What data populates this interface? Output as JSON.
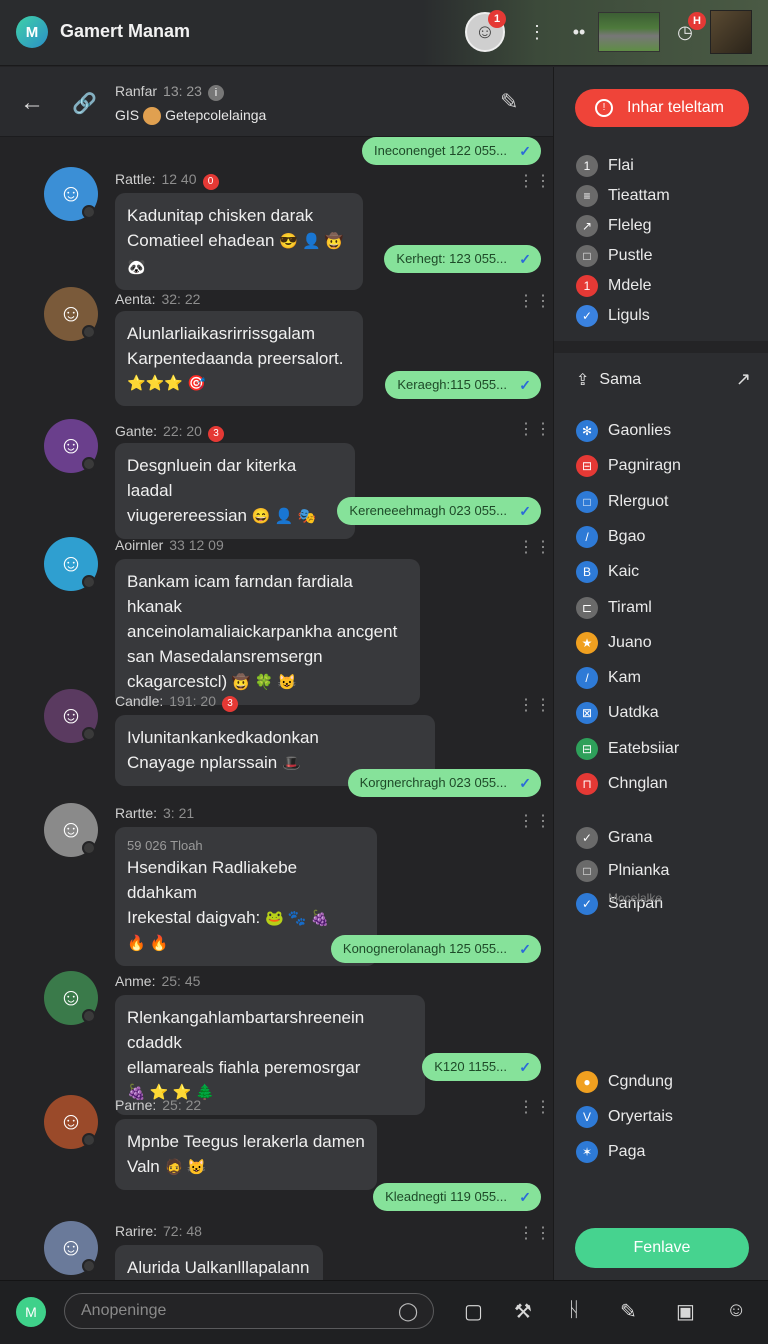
{
  "app": {
    "title": "Gamert Manam",
    "logo": "M"
  },
  "top": {
    "avatar_badge": "1",
    "profile_badge": "H",
    "dots_icon": "⋮",
    "more_icon": "••",
    "timer_icon": "◷"
  },
  "chat_header": {
    "name": "Ranfar",
    "time": "13: 23",
    "info": "i",
    "sub_prefix": "GIS",
    "sub_text": "Getepcolelainga"
  },
  "messages": [
    {
      "id": 1,
      "top": 0,
      "receipt": "Ineconenget 122 055..."
    },
    {
      "id": 2,
      "name": "Rattle:",
      "time": "12 40",
      "badge": "0",
      "avatar_color": "#3b8fd6",
      "text": [
        "Kadunitap chisken darak",
        "Comatieel ehadean"
      ],
      "emoji": "😎 👤 🤠 🐼",
      "receipt": "Kerhegt: 123 055..."
    },
    {
      "id": 3,
      "name": "Aenta:",
      "time": "32: 22",
      "badge": "",
      "avatar_color": "#7a5a3a",
      "text": [
        "Alunlarliaikasrirrissgalam",
        "Karpentedaanda preersalort."
      ],
      "emoji": "⭐⭐⭐ 🎯",
      "receipt": "Keraegh:115 055..."
    },
    {
      "id": 4,
      "name": "Gante:",
      "time": "22: 20",
      "badge": "3",
      "avatar_color": "#6a3f8c",
      "text": [
        "Desgnluein dar kiterka laadal",
        "viugerereessian"
      ],
      "emoji": "😄 👤 🎭",
      "receipt": "Kereneeehmagh 023 055..."
    },
    {
      "id": 5,
      "name": "Aoirnler",
      "time": "33 12 09",
      "badge": "",
      "avatar_color": "#2f9fd0",
      "text": [
        "Bankam icam farndan fardiala hkanak",
        "anceinolamaliaickarpankha ancgent",
        "san Masedalansremsergn",
        "ckagarcestcl)"
      ],
      "emoji": "🤠 🍀 😺",
      "receipt": ""
    },
    {
      "id": 6,
      "name": "Candle:",
      "time": "191: 20",
      "badge": "3",
      "avatar_color": "#5a3a60",
      "text": [
        "Ivlunitankankedkadonkan",
        "Cnayage nplarssain"
      ],
      "emoji": "🎩",
      "receipt": "Korgnerchragh 023 055..."
    },
    {
      "id": 7,
      "name": "Rartte:",
      "time": "3: 21",
      "badge": "",
      "avatar_color": "#8a8a8a",
      "small": "59 026 Tloah",
      "text": [
        "Hsendikan Radliakebe ddahkam",
        "Irekestal daigvah:"
      ],
      "emoji": "🐸 🐾 🍇",
      "emoji2": "🔥 🔥",
      "receipt": "Konognerolanagh 125 055..."
    },
    {
      "id": 8,
      "name": "Anme:",
      "time": "25: 45",
      "badge": "",
      "avatar_color": "#3a7a4a",
      "text": [
        "Rlenkangahlambartarshreenein cdaddk",
        "ellamareals fiahla peremosrgar"
      ],
      "emoji": "🍇 ⭐ ⭐ 🌲",
      "receipt": "K120 1155..."
    },
    {
      "id": 9,
      "name": "Parne:",
      "time": "25: 22",
      "badge": "",
      "avatar_color": "#9a4a2a",
      "text": [
        "Mpnbe Teegus lerakerla damen",
        "Valn"
      ],
      "emoji": "🧔 😺",
      "receipt": "Kleadnegti 119 055..."
    },
    {
      "id": 10,
      "name": "Rarire:",
      "time": "72: 48",
      "badge": "",
      "avatar_color": "#6a7a9a",
      "text": [
        "Alurida Ualkanlllapalann"
      ],
      "emoji": "",
      "receipt": ""
    }
  ],
  "right_panel": {
    "cta_label": "Inhar teleltam",
    "group1": [
      {
        "label": "Flai",
        "icon": "1",
        "color": "#6a6a6a"
      },
      {
        "label": "Tieattam",
        "icon": "≡",
        "color": "#6a6a6a"
      },
      {
        "label": "Fleleg",
        "icon": "↗",
        "color": "#6a6a6a"
      },
      {
        "label": "Pustle",
        "icon": "□",
        "color": "#6a6a6a"
      },
      {
        "label": "Mdele",
        "icon": "1",
        "color": "#e53935"
      },
      {
        "label": "Liguls",
        "icon": "✓",
        "color": "#3a82e0"
      }
    ],
    "share_label": "Sama",
    "group2": [
      {
        "label": "Gaonlies",
        "icon": "✻",
        "color": "#2e7ad6"
      },
      {
        "label": "Pagniragn",
        "icon": "⊟",
        "color": "#e53935"
      },
      {
        "label": "Rlerguot",
        "icon": "□",
        "color": "#2e7ad6"
      },
      {
        "label": "Bgao",
        "icon": "/",
        "color": "#2e7ad6"
      },
      {
        "label": "Kaic",
        "icon": "B",
        "color": "#2e7ad6"
      },
      {
        "label": "Tiraml",
        "icon": "⊏",
        "color": "#6a6a6a"
      },
      {
        "label": "Juano",
        "icon": "★",
        "color": "#f0a020"
      },
      {
        "label": "Kam",
        "icon": "/",
        "color": "#2e7ad6"
      },
      {
        "label": "Uatdka",
        "icon": "⊠",
        "color": "#2e7ad6"
      },
      {
        "label": "Eatebsiiar",
        "icon": "⊟",
        "color": "#2ea05a"
      },
      {
        "label": "Chnglan",
        "icon": "⊓",
        "color": "#e53935"
      }
    ],
    "group3": [
      {
        "label": "Grana",
        "icon": "✓",
        "color": "#6a6a6a"
      },
      {
        "label": "Plnianka",
        "icon": "□",
        "color": "#6a6a6a"
      },
      {
        "label": "Sanpan",
        "icon": "✓",
        "color": "#2e7ad6"
      }
    ],
    "note": "Mocelalke",
    "group4": [
      {
        "label": "Cgndung",
        "icon": "●",
        "color": "#f0a020"
      },
      {
        "label": "Oryertais",
        "icon": "V",
        "color": "#2e7ad6"
      },
      {
        "label": "Pagа",
        "icon": "✶",
        "color": "#2e7ad6"
      }
    ],
    "save_label": "Fenlave"
  },
  "bottom": {
    "placeholder": "Anopeninge",
    "logo": "M"
  }
}
